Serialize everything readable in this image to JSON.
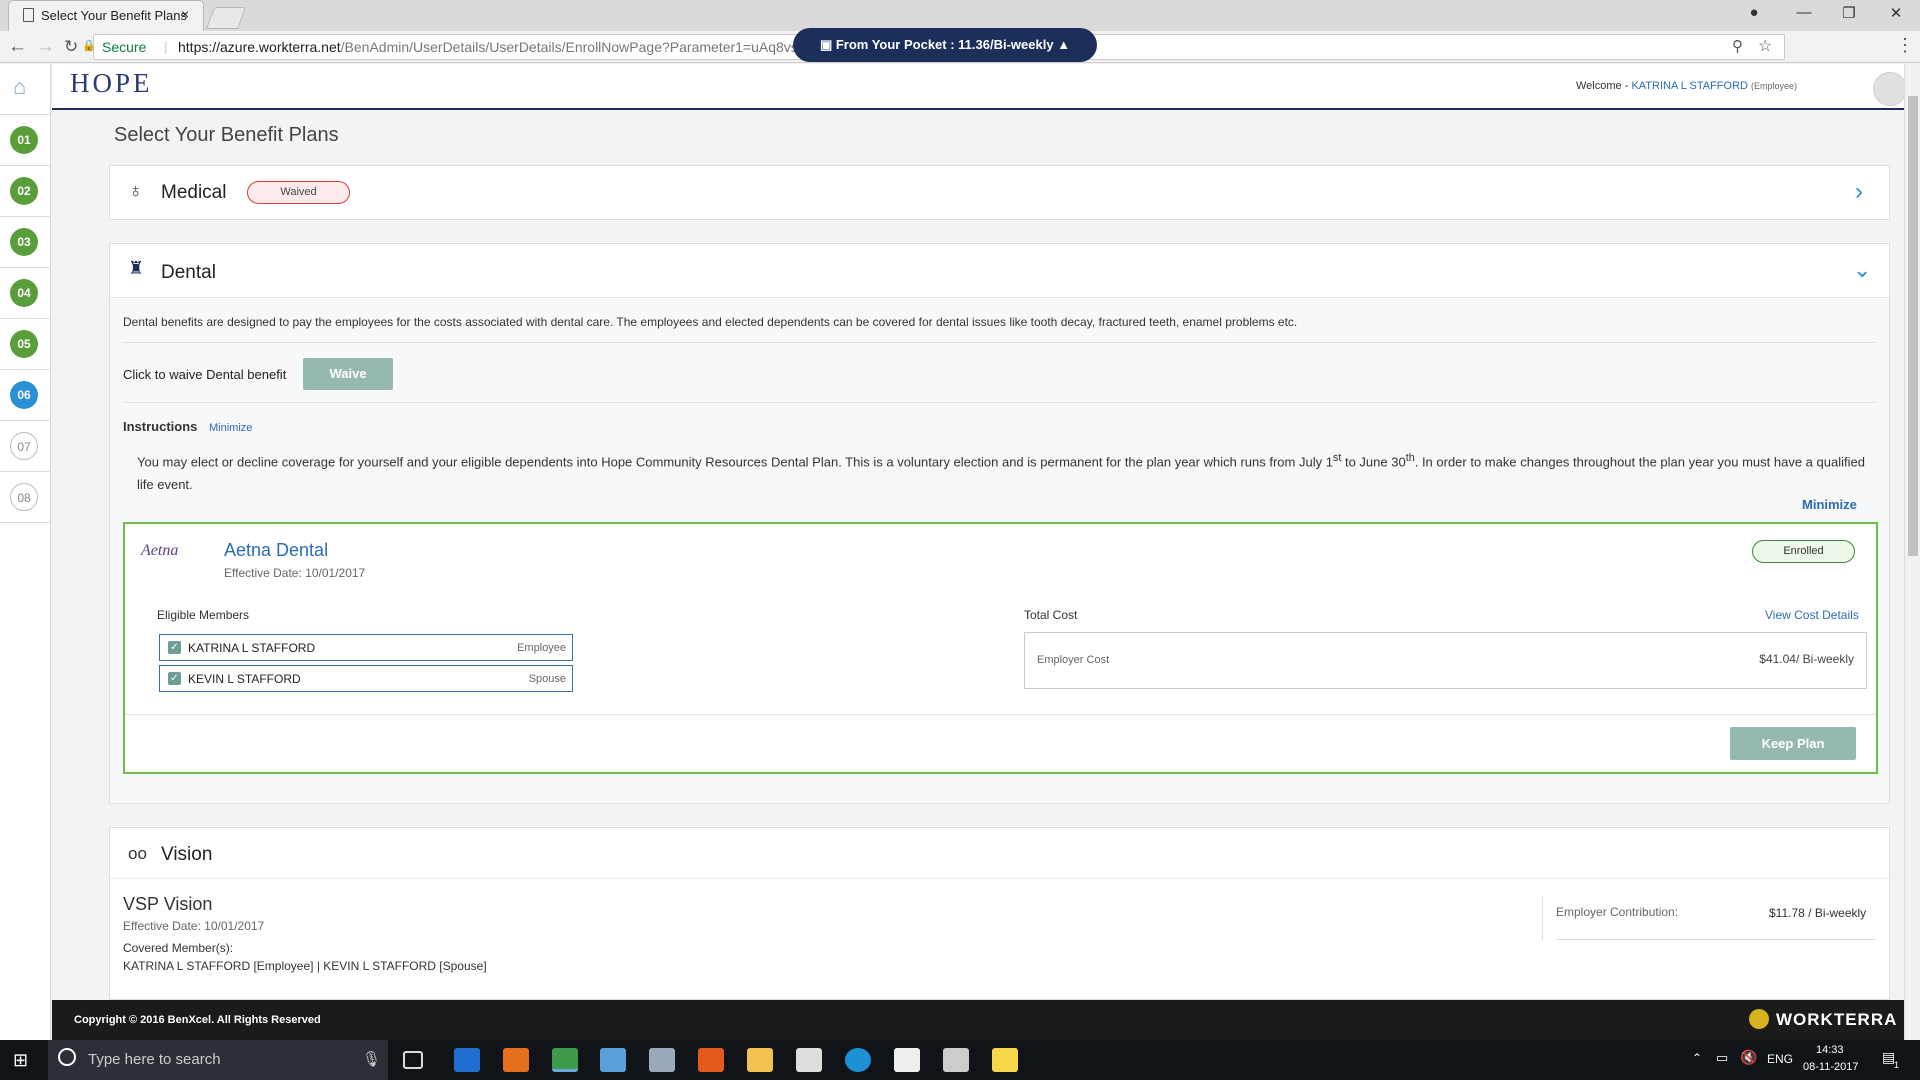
{
  "browser": {
    "tab_title": "Select Your Benefit Plans",
    "tab_close": "×",
    "secure_label": "Secure",
    "url_host": "https://azure.workterra.net",
    "url_path": "/BenAdmin/UserDetails/UserDetails/EnrollNowPage?Parameter1=uAq8vsjHTjlGStQyTnx4QA%3d%3d"
  },
  "rail": {
    "steps": [
      "01",
      "02",
      "03",
      "04",
      "05",
      "06",
      "07",
      "08"
    ],
    "colors": {
      "done": "#5a9e3c",
      "current": "#2a8fd6",
      "pending": "#ffffff"
    }
  },
  "header": {
    "logo": "HOPE",
    "pocket": "From Your Pocket : 11.36/Bi-weekly",
    "welcome_prefix": "Welcome -",
    "user_name": "KATRINA L STAFFORD",
    "user_role": "(Employee)"
  },
  "page": {
    "title": "Select Your Benefit Plans"
  },
  "medical": {
    "title": "Medical",
    "status": "Waived"
  },
  "dental": {
    "title": "Dental",
    "description": "Dental benefits are designed to pay the employees for the costs associated with dental care. The employees and elected dependents can be covered for dental issues like tooth decay, fractured teeth, enamel problems etc.",
    "waive_prompt": "Click to waive Dental benefit",
    "waive_button": "Waive",
    "instructions_label": "Instructions",
    "minimize_link": "Minimize",
    "instructions_part1": "You may elect or decline coverage for yourself and your eligible dependents into Hope Community Resources Dental Plan.  This is a voluntary election and is permanent for the plan year which runs from July 1",
    "sup1": "st",
    "instructions_part2": " to June 30",
    "sup2": "th",
    "instructions_part3": ".  In order to make changes throughout the plan year you must have a qualified life event.",
    "minimize_link2": "Minimize",
    "plan": {
      "carrier_logo": "Aetna",
      "name": "Aetna Dental",
      "effective": "Effective Date: 10/01/2017",
      "status": "Enrolled",
      "members_label": "Eligible Members",
      "members": [
        {
          "name": "KATRINA L STAFFORD",
          "role": "Employee"
        },
        {
          "name": "KEVIN L STAFFORD",
          "role": "Spouse"
        }
      ],
      "total_cost_label": "Total Cost",
      "view_cost": "View Cost Details",
      "employer_cost_label": "Employer Cost",
      "employer_cost_value": "$41.04/ Bi-weekly",
      "keep_button": "Keep Plan"
    }
  },
  "vision": {
    "title": "Vision",
    "plan_name": "VSP Vision",
    "effective": "Effective Date: 10/01/2017",
    "covered_label": "Covered Member(s):",
    "covered": "KATRINA L STAFFORD [Employee]  |  KEVIN L STAFFORD [Spouse]",
    "contrib_label": "Employer Contribution:",
    "contrib_value": "$11.78 / Bi-weekly"
  },
  "footer": {
    "copyright": "Copyright © 2016 BenXcel. All Rights Reserved",
    "brand": "WORKTERRA"
  },
  "taskbar": {
    "search_placeholder": "Type here to search",
    "lang": "ENG",
    "time": "14:33",
    "date": "08-11-2017",
    "notif_count": "1"
  }
}
